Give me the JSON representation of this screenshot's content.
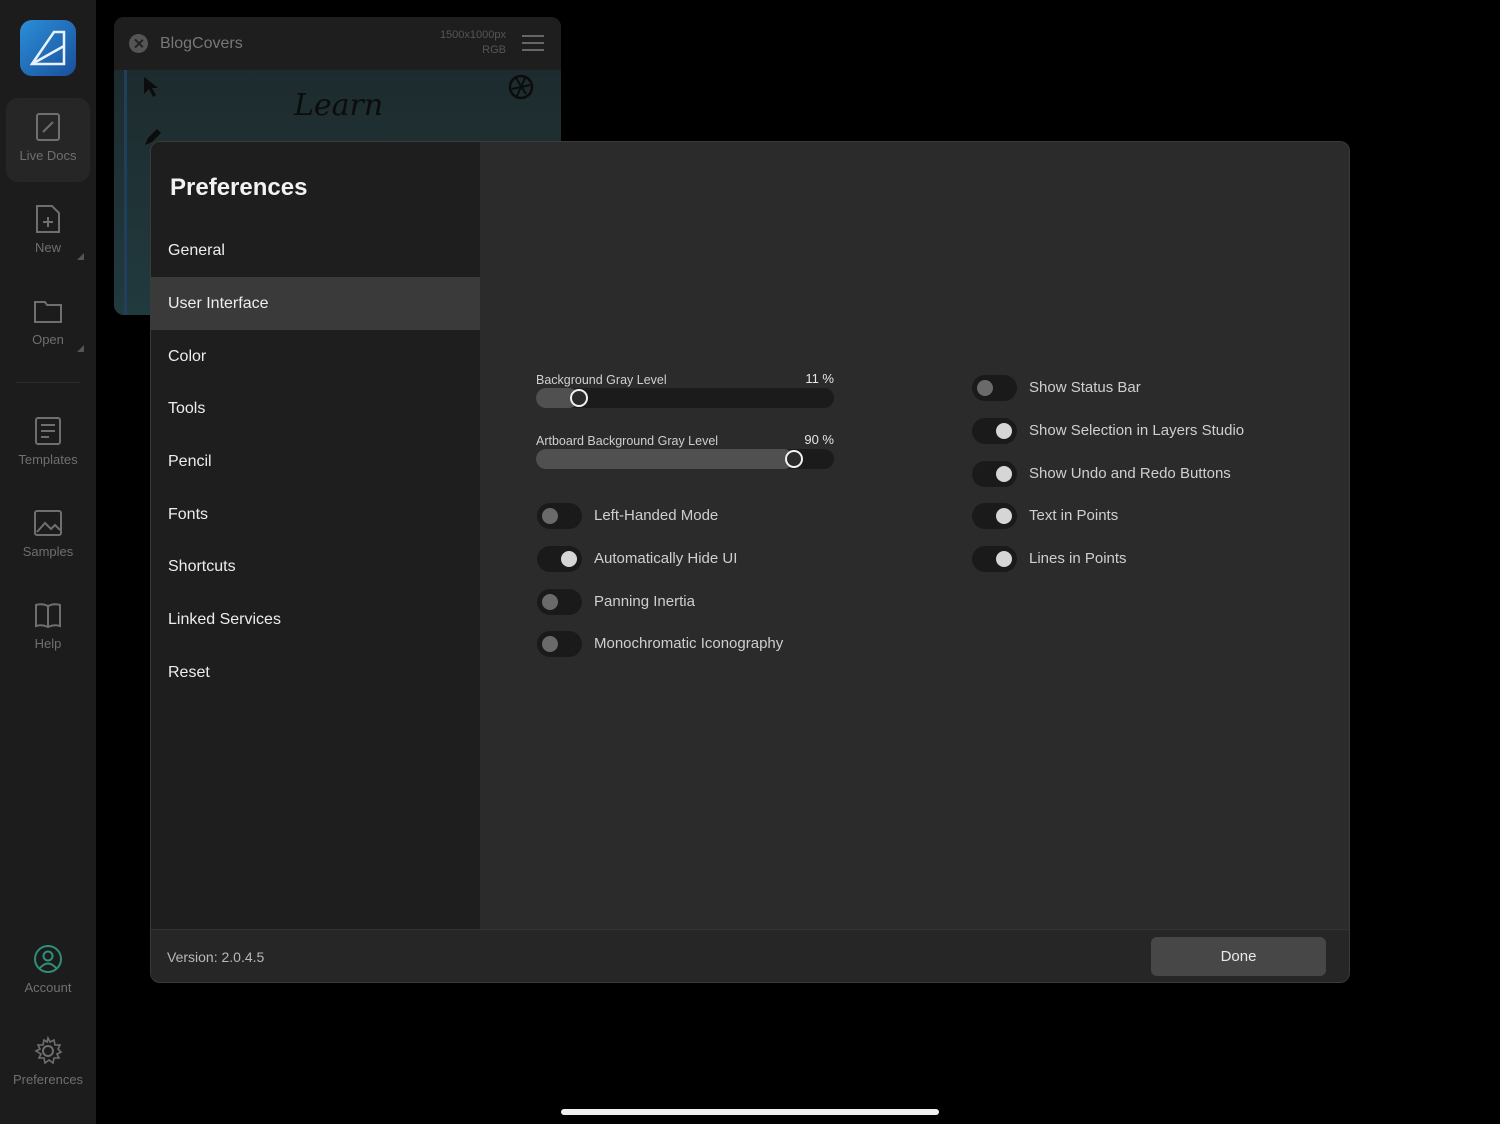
{
  "sidebar": {
    "items": [
      {
        "label": "Live Docs",
        "icon": "document-edit-icon"
      },
      {
        "label": "New",
        "icon": "new-document-icon"
      },
      {
        "label": "Open",
        "icon": "folder-icon"
      },
      {
        "label": "Templates",
        "icon": "templates-icon"
      },
      {
        "label": "Samples",
        "icon": "image-icon"
      },
      {
        "label": "Help",
        "icon": "book-icon"
      },
      {
        "label": "Account",
        "icon": "account-icon"
      },
      {
        "label": "Preferences",
        "icon": "gear-icon"
      }
    ]
  },
  "document": {
    "title": "BlogCovers",
    "size": "1500x1000px",
    "colorspace": "RGB",
    "canvas_text": "Learn"
  },
  "preferences": {
    "title": "Preferences",
    "nav": [
      "General",
      "User Interface",
      "Color",
      "Tools",
      "Pencil",
      "Fonts",
      "Shortcuts",
      "Linked Services",
      "Reset"
    ],
    "active_nav": "User Interface",
    "sliders": [
      {
        "label": "Background Gray Level",
        "value_text": "11 %",
        "value": 11
      },
      {
        "label": "Artboard Background Gray Level",
        "value_text": "90 %",
        "value": 90
      }
    ],
    "left_toggles": [
      {
        "label": "Left-Handed Mode",
        "on": false
      },
      {
        "label": "Automatically Hide UI",
        "on": true
      },
      {
        "label": "Panning Inertia",
        "on": false
      },
      {
        "label": "Monochromatic Iconography",
        "on": false
      }
    ],
    "right_toggles": [
      {
        "label": "Show Status Bar",
        "on": false
      },
      {
        "label": "Show Selection in Layers Studio",
        "on": true
      },
      {
        "label": "Show Undo and Redo Buttons",
        "on": true
      },
      {
        "label": "Text in Points",
        "on": true
      },
      {
        "label": "Lines in Points",
        "on": true
      }
    ],
    "version": "Version: 2.0.4.5",
    "done_label": "Done"
  }
}
